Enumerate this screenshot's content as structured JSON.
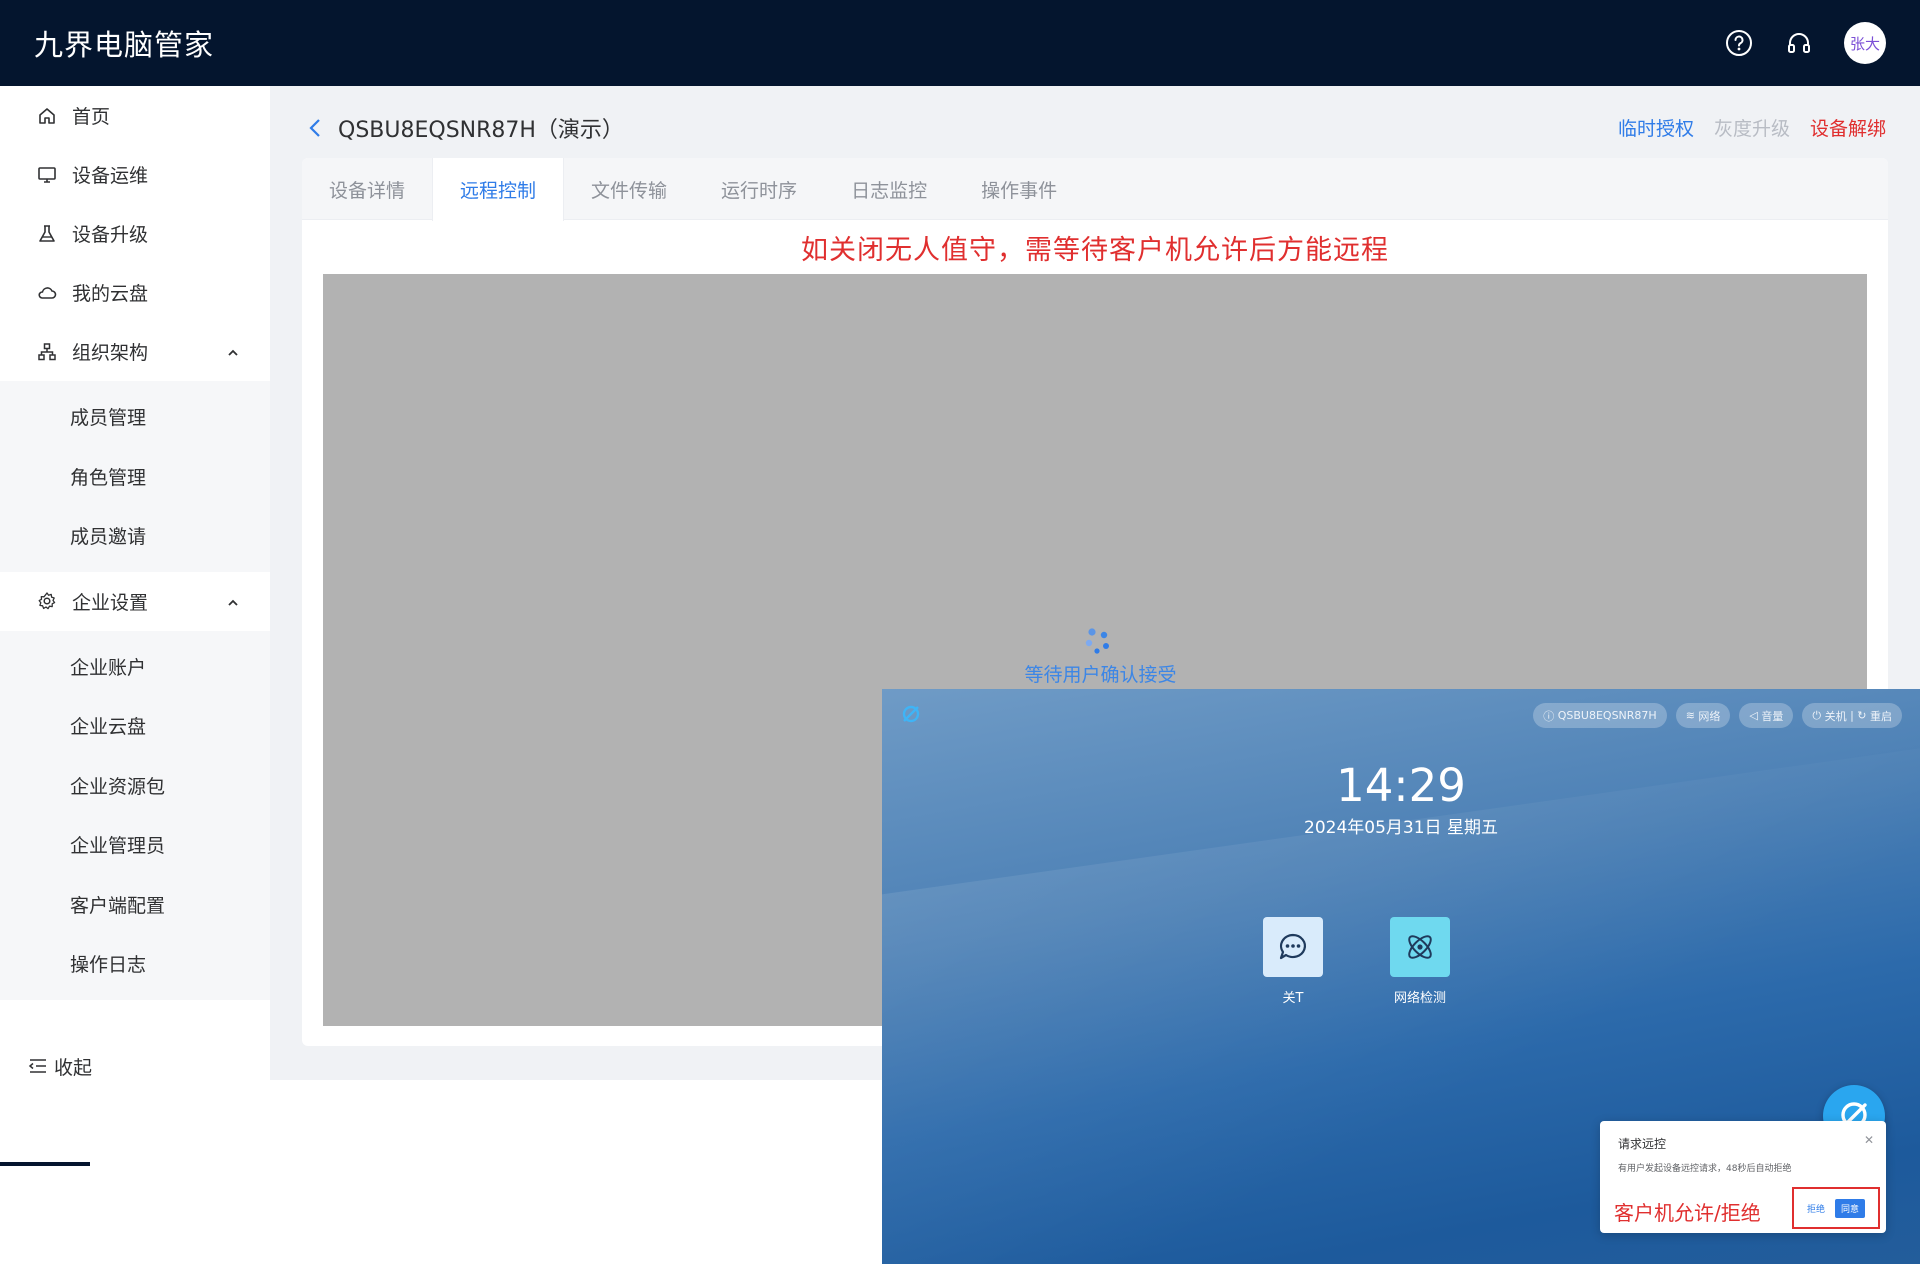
{
  "header": {
    "app_title": "九界电脑管家",
    "avatar_text": "张大",
    "icons": [
      "help-icon",
      "headset-icon"
    ]
  },
  "sidebar": {
    "items": [
      {
        "label": "首页",
        "icon": "home-icon"
      },
      {
        "label": "设备运维",
        "icon": "monitor-icon"
      },
      {
        "label": "设备升级",
        "icon": "flask-icon"
      },
      {
        "label": "我的云盘",
        "icon": "cloud-icon"
      },
      {
        "label": "组织架构",
        "icon": "org-chart-icon",
        "expanded": true
      },
      {
        "label": "企业设置",
        "icon": "gear-icon",
        "expanded": true
      }
    ],
    "org_sub": [
      "成员管理",
      "角色管理",
      "成员邀请"
    ],
    "enterprise_sub": [
      "企业账户",
      "企业云盘",
      "企业资源包",
      "企业管理员",
      "客户端配置",
      "操作日志"
    ],
    "collapse_label": "收起"
  },
  "page": {
    "device_title": "QSBU8EQSNR87H（演示）",
    "actions": {
      "temp_auth": "临时授权",
      "gray_upgrade": "灰度升级",
      "unbind": "设备解绑"
    },
    "colors": {
      "primary": "#2f7ce8",
      "danger": "#e02f2f",
      "disabled": "#b8bcc4",
      "header_bg": "#04152e"
    }
  },
  "tabs": [
    "设备详情",
    "远程控制",
    "文件传输",
    "运行时序",
    "日志监控",
    "操作事件"
  ],
  "active_tab": "远程控制",
  "remote": {
    "notice": "如关闭无人值守，需等待客户机允许后方能远程",
    "waiting_text": "等待用户确认接受"
  },
  "client": {
    "pills": [
      "QSBU8EQSNR87H",
      "网络",
      "音量",
      "关机",
      "重启"
    ],
    "time": "14:29",
    "date": "2024年05月31日 星期五",
    "apps": [
      {
        "label": "关T",
        "icon": "chat-icon"
      },
      {
        "label": "网络检测",
        "icon": "network-check-icon"
      }
    ],
    "popup": {
      "title": "请求远控",
      "message": "有用户发起设备远控请求，48秒后自动拒绝",
      "caption": "客户机允许/拒绝",
      "reject": "拒绝",
      "allow": "同意"
    }
  }
}
